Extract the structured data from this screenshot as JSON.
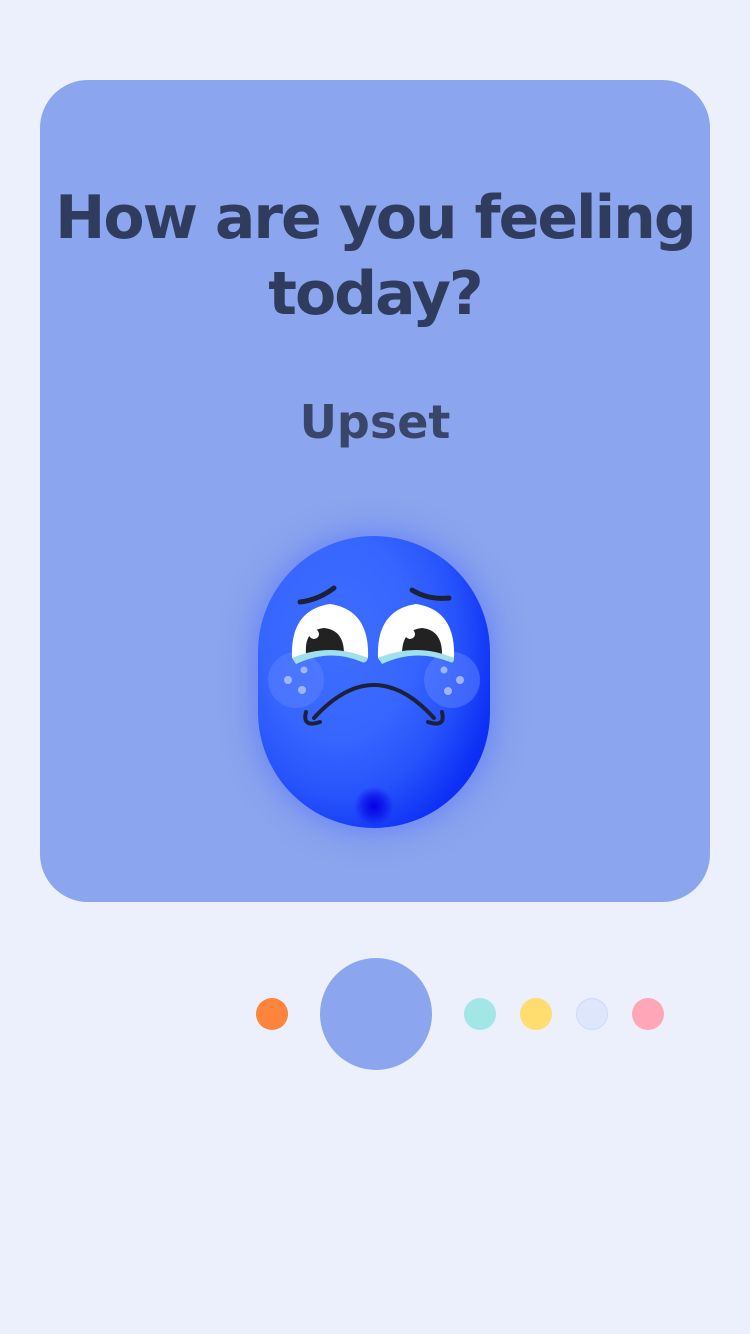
{
  "question": {
    "title": "How are you feeling today?"
  },
  "current_mood": {
    "label": "Upset",
    "face_icon": "upset-face-icon",
    "color": "#3766ff"
  },
  "mood_options": [
    {
      "name": "mood-dot-orange",
      "color": "#ff843c",
      "selected": false
    },
    {
      "name": "mood-dot-blue",
      "color": "#8ba5ee",
      "selected": true
    },
    {
      "name": "mood-dot-teal",
      "color": "#a2e6e8",
      "selected": false
    },
    {
      "name": "mood-dot-yellow",
      "color": "#ffdd6e",
      "selected": false
    },
    {
      "name": "mood-dot-lightblue",
      "color": "#dde6fa",
      "selected": false
    },
    {
      "name": "mood-dot-pink",
      "color": "#ffa6b8",
      "selected": false
    }
  ],
  "colors": {
    "background": "#ebf0fc",
    "card": "#8ba5ee",
    "text": "#2f3c5d"
  }
}
